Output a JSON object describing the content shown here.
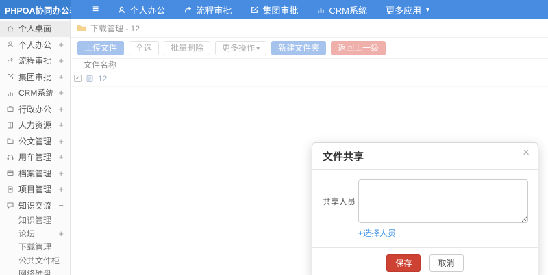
{
  "icons": {
    "hamburger": "≡",
    "caret_down": "▾",
    "check": "✓"
  },
  "colors": {
    "navbar": "#478ce0",
    "logo_bg": "#3a80d2",
    "sidebar_active_bg": "#ececec",
    "btn_blue": "#a6c3ee",
    "btn_red": "#efb0ac",
    "save_red": "#cd4233",
    "link_blue": "#4596e8",
    "folder_yellow": "#f5d28d"
  },
  "navbar": {
    "logo": "PHPOA协同办公软件",
    "items": [
      {
        "label": "个人办公",
        "icon": "user-icon"
      },
      {
        "label": "流程审批",
        "icon": "process-icon"
      },
      {
        "label": "集团审批",
        "icon": "edit-icon"
      },
      {
        "label": "CRM系统",
        "icon": "chart-icon"
      },
      {
        "label": "更多应用",
        "icon": "caret-down-icon"
      }
    ]
  },
  "sidebar": {
    "items": [
      {
        "label": "个人桌面",
        "icon": "home-icon",
        "expand": "",
        "active": true
      },
      {
        "label": "个人办公",
        "icon": "user-icon",
        "expand": "+"
      },
      {
        "label": "流程审批",
        "icon": "process-icon",
        "expand": "+"
      },
      {
        "label": "集团审批",
        "icon": "edit-icon",
        "expand": "+"
      },
      {
        "label": "CRM系统",
        "icon": "chart-icon",
        "expand": "+"
      },
      {
        "label": "行政办公",
        "icon": "briefcase-icon",
        "expand": "+"
      },
      {
        "label": "人力资源",
        "icon": "book-icon",
        "expand": "+"
      },
      {
        "label": "公文管理",
        "icon": "folder-icon",
        "expand": "+"
      },
      {
        "label": "用车管理",
        "icon": "headset-icon",
        "expand": "+"
      },
      {
        "label": "档案管理",
        "icon": "archive-icon",
        "expand": "+"
      },
      {
        "label": "项目管理",
        "icon": "document-icon",
        "expand": "+"
      },
      {
        "label": "知识交流",
        "icon": "chat-icon",
        "expand": "−",
        "children": [
          {
            "label": "知识管理",
            "expand": ""
          },
          {
            "label": "论坛",
            "expand": "+"
          },
          {
            "label": "下载管理",
            "expand": ""
          },
          {
            "label": "公共文件柜",
            "expand": ""
          },
          {
            "label": "网络硬盘",
            "expand": ""
          }
        ]
      }
    ]
  },
  "breadcrumb": {
    "text": "下载管理 - 12"
  },
  "toolbar": {
    "buttons": [
      {
        "label": "上传文件",
        "style": "blue"
      },
      {
        "label": "全选",
        "style": "default"
      },
      {
        "label": "批量删除",
        "style": "default"
      },
      {
        "label": "更多操作",
        "style": "default",
        "caret": true
      },
      {
        "label": "新建文件夹",
        "style": "blue"
      },
      {
        "label": "返回上一级",
        "style": "red"
      }
    ]
  },
  "file_table": {
    "header": "文件名称",
    "rows": [
      {
        "name": "12",
        "checked": true
      }
    ]
  },
  "modal": {
    "title": "文件共享",
    "close_icon": "×",
    "field_label": "共享人员",
    "textarea_value": "",
    "select_link": "+选择人员",
    "save_label": "保存",
    "cancel_label": "取消"
  }
}
